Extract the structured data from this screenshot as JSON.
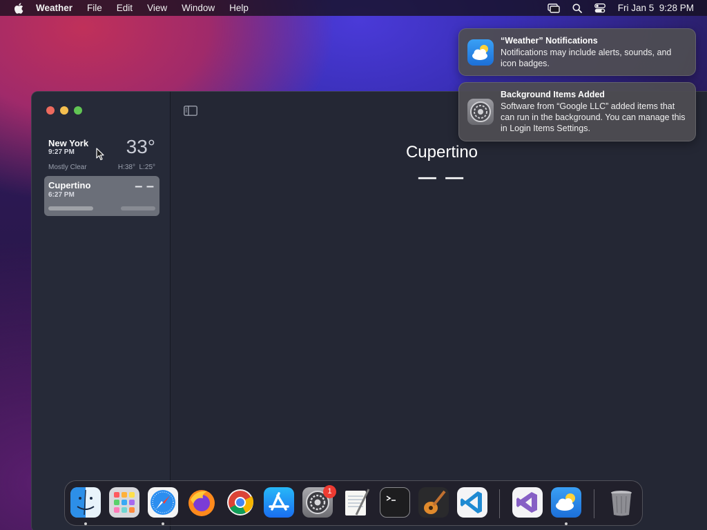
{
  "menubar": {
    "app_name": "Weather",
    "items": [
      "File",
      "Edit",
      "View",
      "Window",
      "Help"
    ],
    "datetime": "Fri Jan 5  9:28 PM",
    "status_icons": [
      "screen-mirroring-icon",
      "search-icon",
      "control-center-icon"
    ]
  },
  "sidebar": {
    "locations": [
      {
        "city": "New York",
        "time": "9:27 PM",
        "temp": "33°",
        "condition": "Mostly Clear",
        "high_low": "H:38°  L:25°"
      },
      {
        "city": "Cupertino",
        "time": "6:27 PM",
        "temp": "– –"
      }
    ]
  },
  "main": {
    "city": "Cupertino",
    "temp": "— —"
  },
  "notifications": [
    {
      "icon": "weather-app-icon",
      "title": "“Weather” Notifications",
      "body": "Notifications may include alerts, sounds, and icon badges."
    },
    {
      "icon": "system-settings-icon",
      "title": "Background Items Added",
      "body": "Software from “Google LLC” added items that can run in the background. You can manage this in Login Items Settings."
    }
  ],
  "dock": {
    "apps": [
      "Finder",
      "Launchpad",
      "Safari",
      "Firefox",
      "Google Chrome",
      "App Store",
      "System Settings",
      "TextEdit",
      "Terminal",
      "GarageBand",
      "Visual Studio Code",
      "Visual Studio",
      "Weather",
      "Trash"
    ],
    "system_settings_badge": "1"
  },
  "colors": {
    "close": "#ed6a5e",
    "minimize": "#f5bf4f",
    "zoom": "#61c554",
    "badge": "#ee3b32"
  }
}
